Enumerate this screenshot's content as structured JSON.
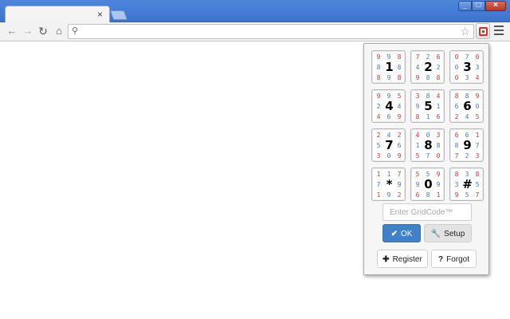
{
  "browser": {
    "tab_close": "×",
    "search_icon": "search-icon",
    "star_icon": "star-icon"
  },
  "popup": {
    "grid": [
      {
        "digit": "1",
        "small": [
          "9",
          "9",
          "8",
          "8",
          "8",
          "8",
          "9",
          "8"
        ]
      },
      {
        "digit": "2",
        "small": [
          "7",
          "2",
          "6",
          "4",
          "2",
          "9",
          "8",
          "8"
        ]
      },
      {
        "digit": "3",
        "small": [
          "0",
          "7",
          "0",
          "0",
          "3",
          "0",
          "3",
          "4"
        ]
      },
      {
        "digit": "4",
        "small": [
          "9",
          "9",
          "5",
          "2",
          "4",
          "4",
          "6",
          "9"
        ]
      },
      {
        "digit": "5",
        "small": [
          "3",
          "8",
          "4",
          "9",
          "1",
          "8",
          "1",
          "6"
        ]
      },
      {
        "digit": "6",
        "small": [
          "8",
          "8",
          "9",
          "6",
          "0",
          "2",
          "4",
          "5"
        ]
      },
      {
        "digit": "7",
        "small": [
          "2",
          "4",
          "2",
          "5",
          "6",
          "3",
          "0",
          "9"
        ]
      },
      {
        "digit": "8",
        "small": [
          "4",
          "0",
          "3",
          "1",
          "8",
          "5",
          "7",
          "0"
        ]
      },
      {
        "digit": "9",
        "small": [
          "6",
          "6",
          "1",
          "8",
          "7",
          "7",
          "2",
          "3"
        ]
      },
      {
        "digit": "*",
        "small": [
          "1",
          "1",
          "7",
          "7",
          "9",
          "1",
          "9",
          "2"
        ]
      },
      {
        "digit": "0",
        "small": [
          "5",
          "5",
          "9",
          "9",
          "9",
          "6",
          "8",
          "1"
        ]
      },
      {
        "digit": "#",
        "small": [
          "8",
          "3",
          "8",
          "3",
          "5",
          "9",
          "5",
          "7"
        ]
      }
    ],
    "gridcode_placeholder": "Enter GridCode™",
    "ok_label": "OK",
    "setup_label": "Setup",
    "register_label": "Register",
    "forgot_label": "Forgot",
    "colors": {
      "accent": "#3f82c9",
      "small_red": "#d03a3a",
      "small_blue": "#4a78c9"
    }
  }
}
